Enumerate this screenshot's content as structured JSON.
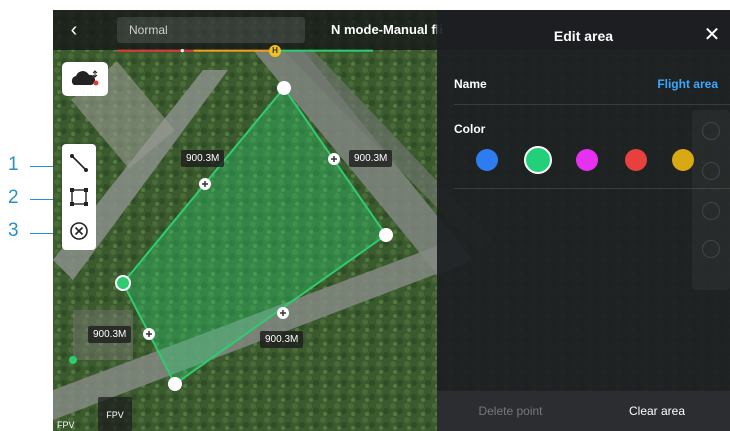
{
  "callouts": [
    "1",
    "2",
    "3"
  ],
  "topbar": {
    "back_icon": "back-chevron-icon",
    "mode_value": "Normal",
    "title": "N mode-Manual fli"
  },
  "map": {
    "takeoff_marker": "H",
    "distances": [
      "900.3M",
      "900.3M",
      "900.3M",
      "900.3M"
    ],
    "fpv_label": "FPV",
    "fpv_corner": "FPV",
    "area_color": "#2ecc71"
  },
  "toolbar": {
    "items": [
      {
        "icon": "line-tool-icon"
      },
      {
        "icon": "area-tool-icon"
      },
      {
        "icon": "delete-tool-icon"
      }
    ]
  },
  "panel": {
    "title": "Edit area",
    "name_label": "Name",
    "name_value": "Flight area",
    "color_label": "Color",
    "colors": [
      "#2e7df0",
      "#22d07a",
      "#e632f0",
      "#e8403c",
      "#d9a814"
    ],
    "selected_color_index": 1,
    "delete_label": "Delete point",
    "clear_label": "Clear area"
  }
}
